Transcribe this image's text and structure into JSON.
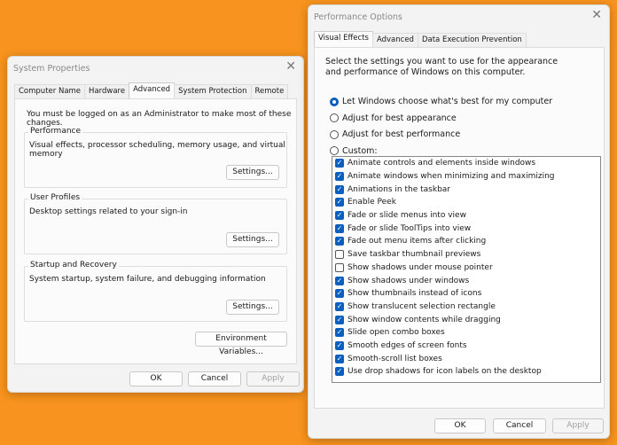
{
  "background_color": "#f7931e",
  "system_properties": {
    "title": "System Properties",
    "tabs": [
      "Computer Name",
      "Hardware",
      "Advanced",
      "System Protection",
      "Remote"
    ],
    "active_tab": "Advanced",
    "admin_note": "You must be logged on as an Administrator to make most of these changes.",
    "performance": {
      "label": "Performance",
      "text": "Visual effects, processor scheduling, memory usage, and virtual memory",
      "button": "Settings..."
    },
    "user_profiles": {
      "label": "User Profiles",
      "text": "Desktop settings related to your sign-in",
      "button": "Settings..."
    },
    "startup": {
      "label": "Startup and Recovery",
      "text": "System startup, system failure, and debugging information",
      "button": "Settings..."
    },
    "env_button": "Environment Variables...",
    "ok": "OK",
    "cancel": "Cancel",
    "apply": "Apply"
  },
  "performance_options": {
    "title": "Performance Options",
    "tabs": [
      "Visual Effects",
      "Advanced",
      "Data Execution Prevention"
    ],
    "active_tab": "Visual Effects",
    "description": "Select the settings you want to use for the appearance and performance of Windows on this computer.",
    "radios": [
      {
        "label": "Let Windows choose what's best for my computer",
        "selected": true
      },
      {
        "label": "Adjust for best appearance",
        "selected": false
      },
      {
        "label": "Adjust for best performance",
        "selected": false
      },
      {
        "label": "Custom:",
        "selected": false
      }
    ],
    "options": [
      {
        "label": "Animate controls and elements inside windows",
        "checked": true
      },
      {
        "label": "Animate windows when minimizing and maximizing",
        "checked": true
      },
      {
        "label": "Animations in the taskbar",
        "checked": true
      },
      {
        "label": "Enable Peek",
        "checked": true
      },
      {
        "label": "Fade or slide menus into view",
        "checked": true
      },
      {
        "label": "Fade or slide ToolTips into view",
        "checked": true
      },
      {
        "label": "Fade out menu items after clicking",
        "checked": true
      },
      {
        "label": "Save taskbar thumbnail previews",
        "checked": false
      },
      {
        "label": "Show shadows under mouse pointer",
        "checked": false
      },
      {
        "label": "Show shadows under windows",
        "checked": true
      },
      {
        "label": "Show thumbnails instead of icons",
        "checked": true
      },
      {
        "label": "Show translucent selection rectangle",
        "checked": true
      },
      {
        "label": "Show window contents while dragging",
        "checked": true
      },
      {
        "label": "Slide open combo boxes",
        "checked": true
      },
      {
        "label": "Smooth edges of screen fonts",
        "checked": true
      },
      {
        "label": "Smooth-scroll list boxes",
        "checked": true
      },
      {
        "label": "Use drop shadows for icon labels on the desktop",
        "checked": true
      }
    ],
    "ok": "OK",
    "cancel": "Cancel",
    "apply": "Apply"
  }
}
